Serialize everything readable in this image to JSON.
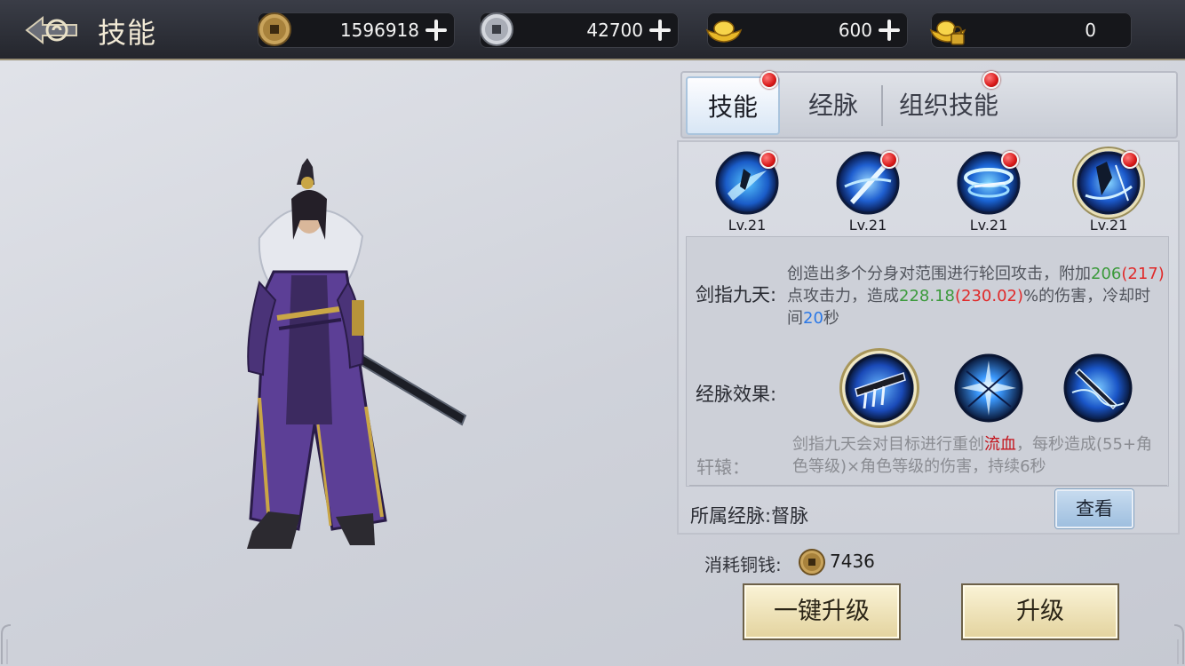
{
  "header": {
    "title": "技能"
  },
  "currencies": [
    {
      "icon": "copper-coin-icon",
      "value": "1596918"
    },
    {
      "icon": "silver-coin-icon",
      "value": "42700"
    },
    {
      "icon": "gold-ingot-icon",
      "value": "600"
    },
    {
      "icon": "locked-gold-ingot-icon",
      "value": "0"
    }
  ],
  "tabs": [
    {
      "label": "技能",
      "active": true,
      "badge": true
    },
    {
      "label": "经脉",
      "active": false,
      "badge": false
    },
    {
      "label": "组织技能",
      "active": false,
      "badge": true
    }
  ],
  "skills": [
    {
      "level": "Lv.21",
      "icon": "skill-slash-icon",
      "badge": true,
      "selected": false
    },
    {
      "level": "Lv.21",
      "icon": "skill-thrust-icon",
      "badge": true,
      "selected": false
    },
    {
      "level": "Lv.21",
      "icon": "skill-whirl-icon",
      "badge": true,
      "selected": false
    },
    {
      "level": "Lv.21",
      "icon": "skill-swords-icon",
      "badge": true,
      "selected": true
    }
  ],
  "detail": {
    "skill_label": "剑指九天:",
    "desc_parts": {
      "p1": "创造出多个分身对范围进行轮回攻击，附加",
      "v1": "206",
      "v1b": "(217)",
      "p2": "点攻击力，造成",
      "v2": "228.18",
      "v2b": "(230.02)",
      "p3": "%的伤害，冷却时间",
      "v3": "20",
      "p4": "秒"
    },
    "meridian_label": "经脉效果:",
    "meridians": [
      {
        "icon": "meridian-claws-icon",
        "selected": true
      },
      {
        "icon": "meridian-shatter-icon",
        "selected": false
      },
      {
        "icon": "meridian-sword-icon",
        "selected": false
      }
    ],
    "effect_label": "轩辕：",
    "effect_parts": {
      "p1": "剑指九天会对目标进行重创",
      "k1": "流血",
      "p2": "，每秒造成(55+角色等级)×角色等级的伤害，持续6秒"
    },
    "belong_label": "所属经脉:督脉",
    "view_button": "查看"
  },
  "cost": {
    "label": "消耗铜钱:",
    "value": "7436",
    "icon": "copper-coin-icon"
  },
  "buttons": {
    "one_click_upgrade": "一键升级",
    "upgrade": "升级"
  },
  "colors": {
    "positive": "#3c9a3c",
    "bonus": "#e02a2a",
    "cooldown": "#2b78e6",
    "badge": "#d81818"
  }
}
